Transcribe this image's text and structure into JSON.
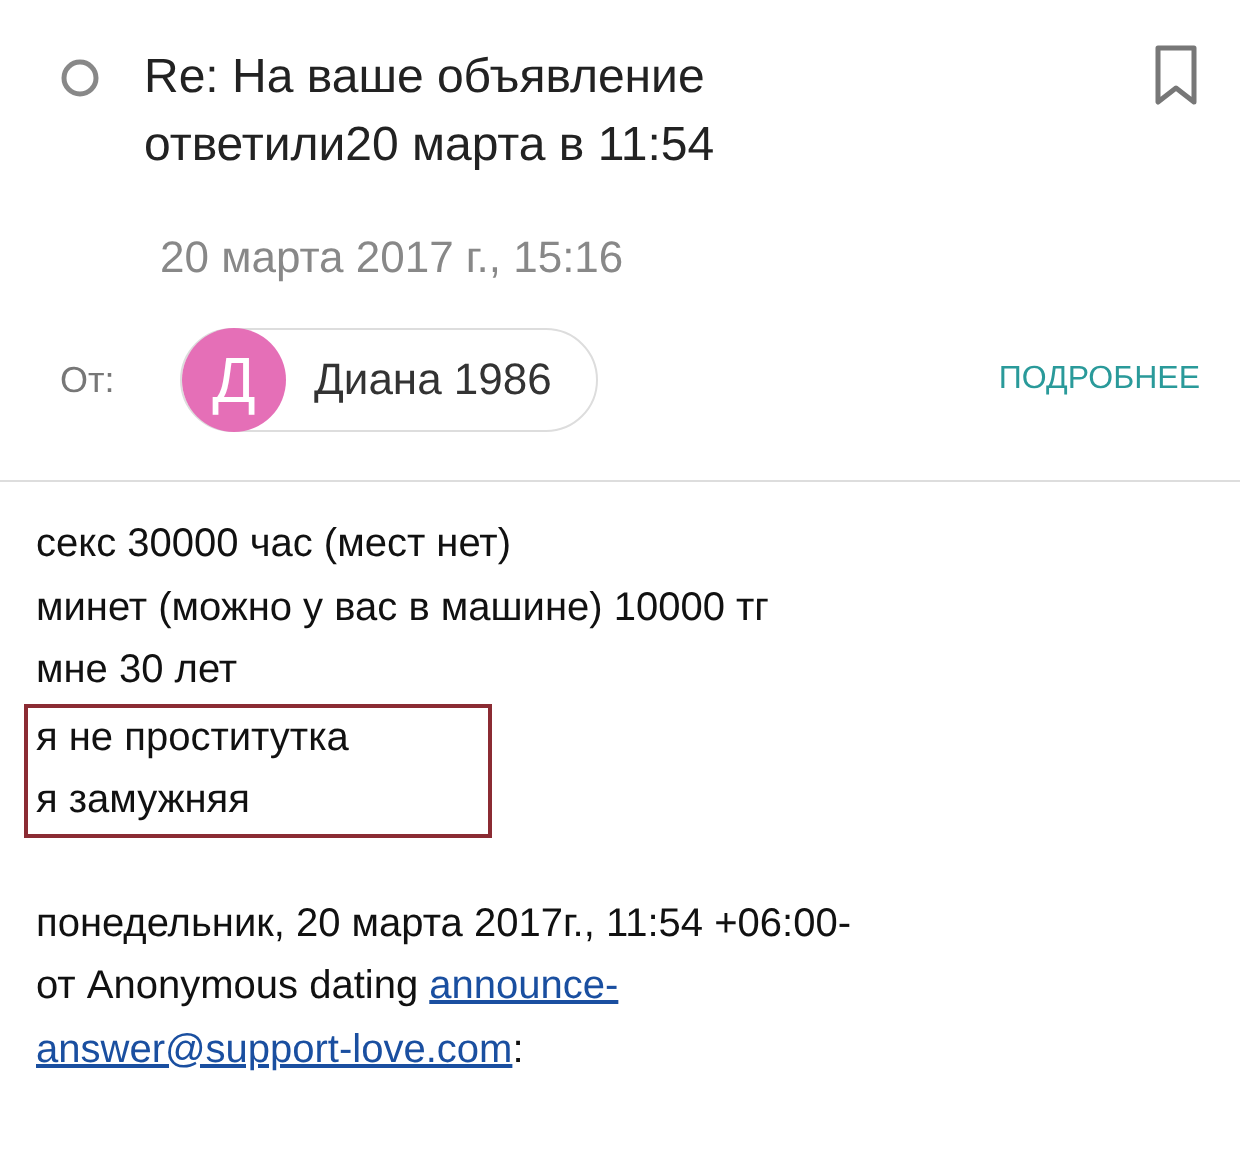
{
  "message": {
    "subject_lines": [
      "Re: На ваше объявление",
      "ответили20 марта в 11:54"
    ],
    "date": "20 марта 2017 г., 15:16",
    "from_label": "От:",
    "sender": {
      "initial": "Д",
      "name": "Диана 1986"
    },
    "details_link": "ПОДРОБНЕЕ"
  },
  "body": {
    "lines": [
      {
        "text": "секс 30000 час (мест нет)",
        "boxed": false
      },
      {
        "text": "минет (можно у вас в машине) 10000 тг",
        "boxed": false
      },
      {
        "text": "мне 30 лет",
        "boxed": false
      },
      {
        "text": "я не проститутка",
        "boxed": true
      },
      {
        "text": "я замужняя",
        "boxed": true
      }
    ]
  },
  "quote": {
    "line": "понедельник, 20 марта 2017г., 11:54 +06:00-",
    "from_text": "от Anonymous dating",
    "link_parts": [
      "announce-",
      "answer@support-love.com"
    ],
    "suffix": ":"
  }
}
